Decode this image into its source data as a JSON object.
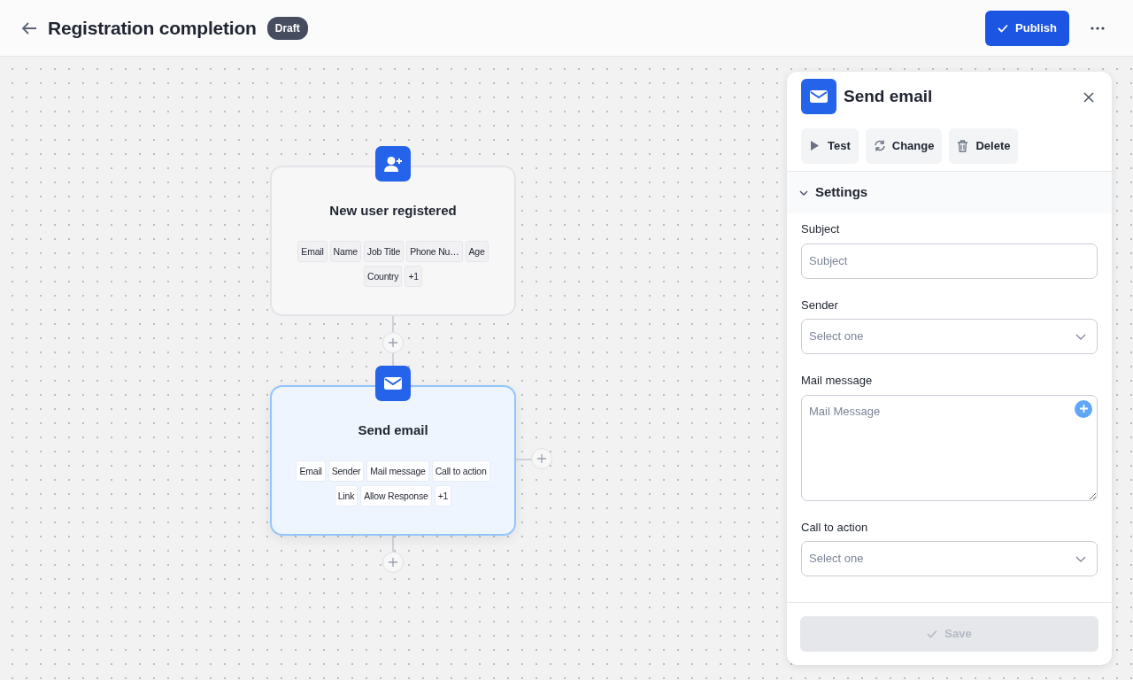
{
  "header": {
    "title": "Registration completion",
    "status": "Draft",
    "publish_label": "Publish"
  },
  "nodes": [
    {
      "kind": "trigger",
      "title": "New user registered",
      "selected": false,
      "fields": [
        "Email",
        "Name",
        "Job Title",
        "Phone Nu…",
        "Age",
        "Country",
        "+1"
      ]
    },
    {
      "kind": "email",
      "title": "Send email",
      "selected": true,
      "fields": [
        "Email",
        "Sender",
        "Mail message",
        "Call to action",
        "Link",
        "Allow Response",
        "+1"
      ]
    }
  ],
  "panel": {
    "title": "Send email",
    "actions": [
      {
        "kind": "test",
        "label": "Test"
      },
      {
        "kind": "change",
        "label": "Change"
      },
      {
        "kind": "delete",
        "label": "Delete"
      }
    ],
    "section": {
      "title": "Settings",
      "expanded": true
    },
    "fields": [
      {
        "kind": "input",
        "label": "Subject",
        "placeholder": "Subject"
      },
      {
        "kind": "select",
        "label": "Sender",
        "placeholder": "Select one"
      },
      {
        "kind": "textarea",
        "label": "Mail message",
        "placeholder": "Mail Message"
      },
      {
        "kind": "select",
        "label": "Call to action",
        "placeholder": "Select one"
      }
    ],
    "save": {
      "label": "Save",
      "disabled": true
    }
  }
}
